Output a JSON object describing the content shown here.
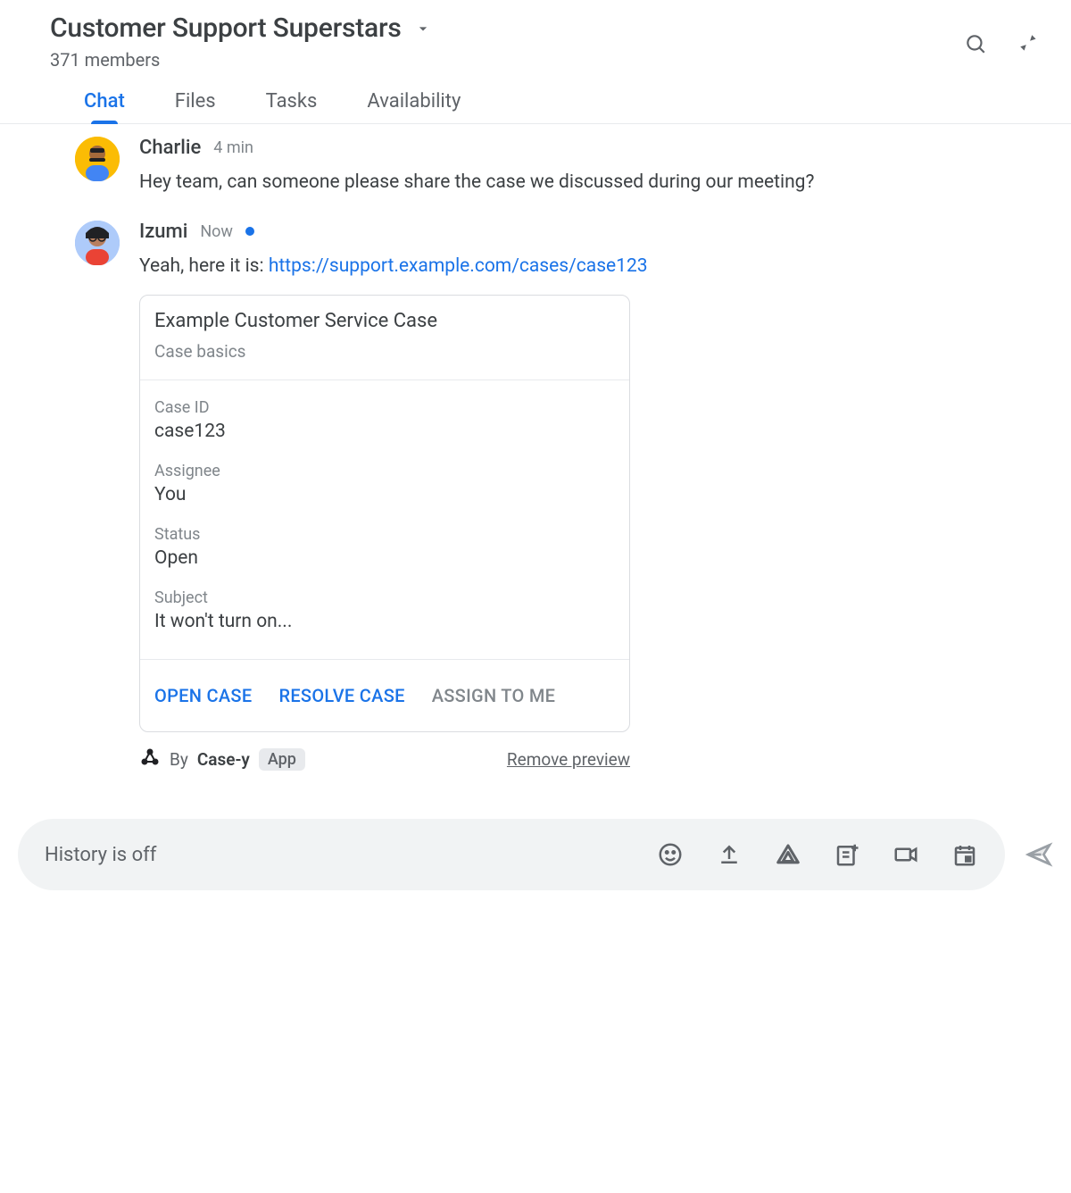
{
  "header": {
    "title": "Customer Support Superstars",
    "members": "371 members"
  },
  "tabs": [
    "Chat",
    "Files",
    "Tasks",
    "Availability"
  ],
  "active_tab": 0,
  "messages": [
    {
      "author": "Charlie",
      "time": "4 min",
      "has_dot": false,
      "text": "Hey team, can someone please share the case we discussed during our meeting?"
    },
    {
      "author": "Izumi",
      "time": "Now",
      "has_dot": true,
      "text_prefix": "Yeah, here it is: ",
      "link_text": "https://support.example.com/cases/case123"
    }
  ],
  "card": {
    "title": "Example Customer Service Case",
    "subtitle": "Case basics",
    "fields": [
      {
        "label": "Case ID",
        "value": "case123"
      },
      {
        "label": "Assignee",
        "value": "You"
      },
      {
        "label": "Status",
        "value": "Open"
      },
      {
        "label": "Subject",
        "value": "It won't turn on..."
      }
    ],
    "actions": {
      "open": "OPEN CASE",
      "resolve": "RESOLVE CASE",
      "assign": "ASSIGN TO ME"
    },
    "attribution": {
      "by_prefix": "By",
      "by_name": "Case-y",
      "badge": "App",
      "remove": "Remove preview"
    }
  },
  "composer": {
    "placeholder": "History is off"
  }
}
